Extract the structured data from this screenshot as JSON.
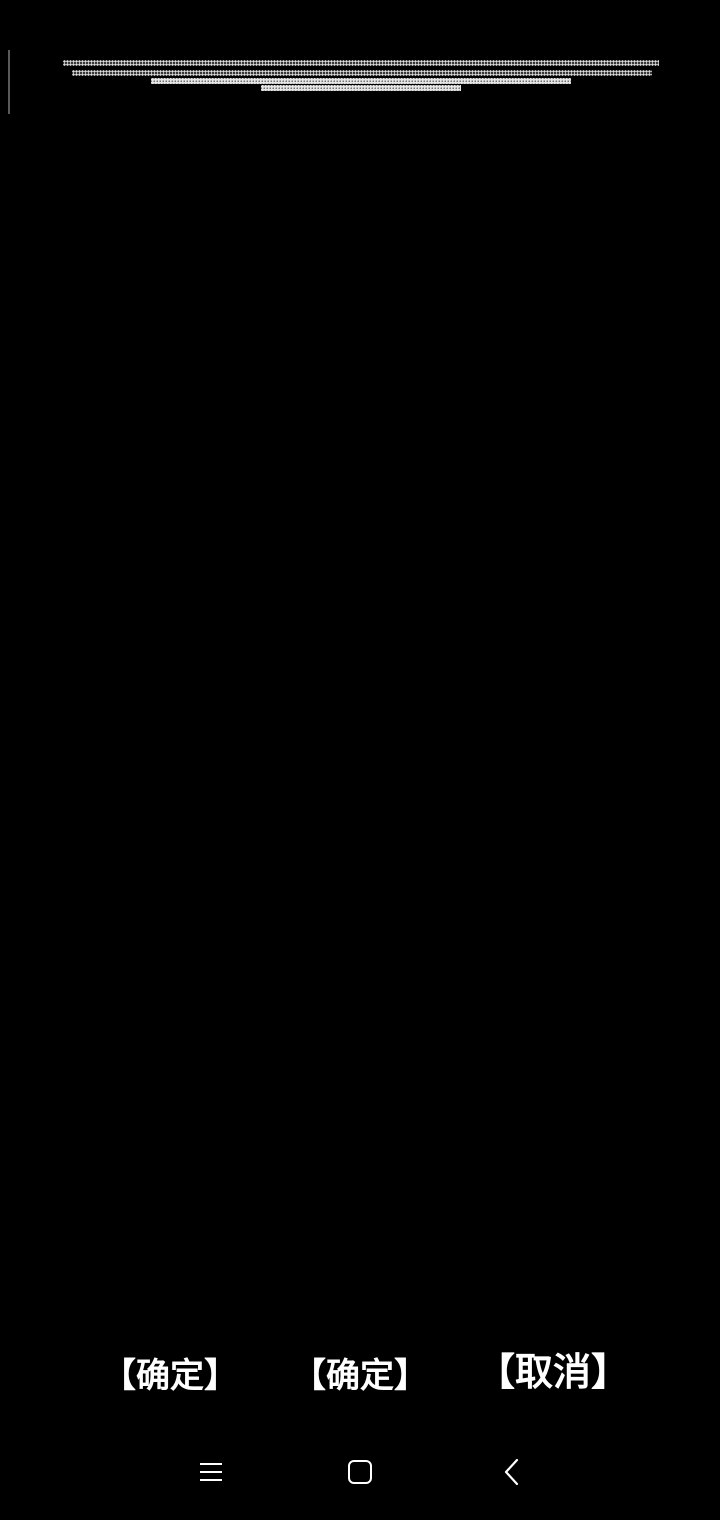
{
  "screen": {
    "background": "#000000",
    "foreground": "#ffffff"
  },
  "actions": {
    "confirm_1": "【确定】",
    "confirm_2": "【确定】",
    "cancel": "【取消】"
  },
  "navigation": {
    "menu_icon": "menu-icon",
    "home_icon": "home-icon",
    "back_icon": "back-icon"
  }
}
